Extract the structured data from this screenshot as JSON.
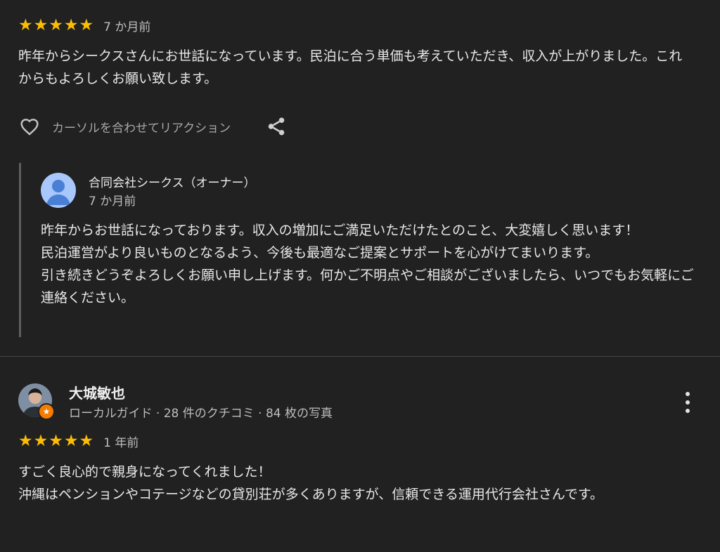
{
  "review1": {
    "stars": 5,
    "time": "7 か月前",
    "text": "昨年からシークスさんにお世話になっています。民泊に合う単価も考えていただき、収入が上がりました。これからもよろしくお願い致します。",
    "react_label": "カーソルを合わせてリアクション",
    "icons": {
      "react": "heart-outline-icon",
      "share": "share-icon"
    }
  },
  "owner_response": {
    "name": "合同会社シークス（オーナー）",
    "time": "7 か月前",
    "text": "昨年からお世話になっております。収入の増加にご満足いただけたとのこと、大変嬉しく思います！\n民泊運営がより良いものとなるよう、今後も最適なご提案とサポートを心がけてまいります。\n引き続きどうぞよろしくお願い申し上げます。何かご不明点やご相談がございましたら、いつでもお気軽にご連絡ください。"
  },
  "review2": {
    "user_name": "大城敏也",
    "user_sub": "ローカルガイド · 28 件のクチコミ · 84 枚の写真",
    "stars": 5,
    "time": "1 年前",
    "text": "すごく良心的で親身になってくれました！\n沖縄はペンションやコテージなどの貸別荘が多くありますが、信頼できる運用代行会社さんです。",
    "icons": {
      "more": "more-vert-icon",
      "badge": "local-guide-badge-icon"
    }
  },
  "colors": {
    "star": "#fbbc04",
    "background": "#212121",
    "badge": "#f57c00"
  }
}
